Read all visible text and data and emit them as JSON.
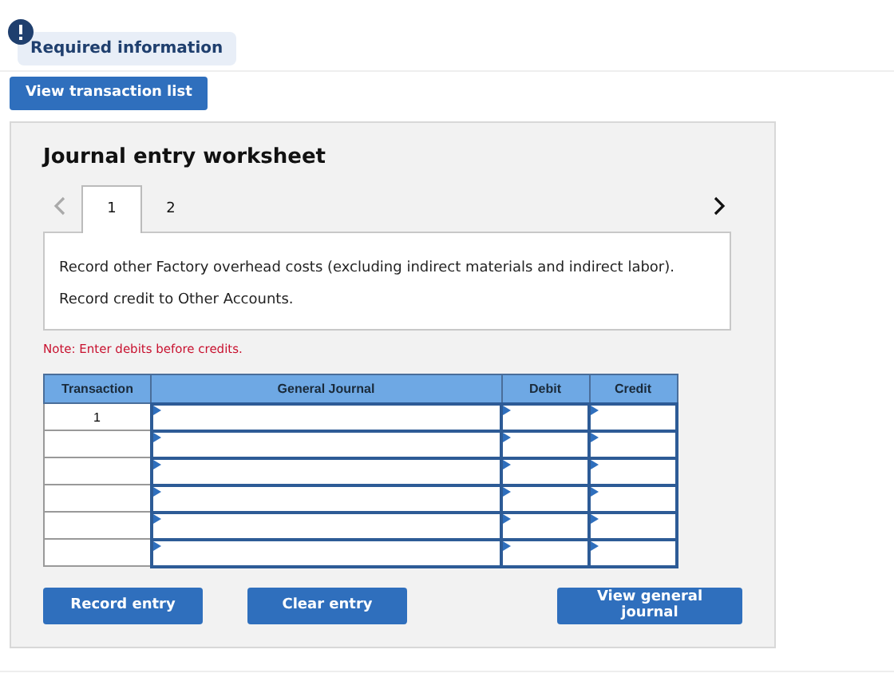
{
  "notice": {
    "label": "Required information"
  },
  "top_button": "View transaction list",
  "worksheet": {
    "title": "Journal entry worksheet",
    "nav": {
      "prev": {
        "disabled": true
      },
      "next": {
        "disabled": false
      }
    },
    "tabs": [
      {
        "label": "1",
        "selected": true
      },
      {
        "label": "2",
        "selected": false
      }
    ],
    "instruction": "Record other Factory overhead costs (excluding indirect materials and indirect labor). Record credit to Other Accounts.",
    "note": "Note: Enter debits before credits.",
    "table": {
      "columns": [
        "Transaction",
        "General Journal",
        "Debit",
        "Credit"
      ],
      "rows": [
        {
          "transaction": "1"
        },
        {},
        {},
        {},
        {},
        {}
      ]
    },
    "buttons": [
      "Record entry",
      "Clear entry",
      "View general journal"
    ]
  }
}
